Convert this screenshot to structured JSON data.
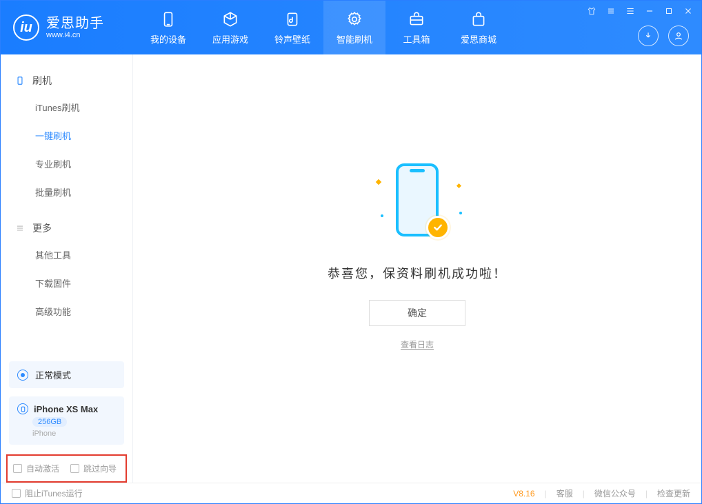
{
  "header": {
    "logo_title": "爱思助手",
    "logo_sub": "www.i4.cn",
    "nav": [
      {
        "label": "我的设备",
        "icon": "phone-icon"
      },
      {
        "label": "应用游戏",
        "icon": "cube-icon"
      },
      {
        "label": "铃声壁纸",
        "icon": "music-icon"
      },
      {
        "label": "智能刷机",
        "icon": "refresh-badge-icon",
        "active": true
      },
      {
        "label": "工具箱",
        "icon": "toolbox-icon"
      },
      {
        "label": "爱思商城",
        "icon": "store-icon"
      }
    ]
  },
  "sidebar": {
    "section1_title": "刷机",
    "items1": [
      {
        "label": "iTunes刷机"
      },
      {
        "label": "一键刷机",
        "active": true
      },
      {
        "label": "专业刷机"
      },
      {
        "label": "批量刷机"
      }
    ],
    "section2_title": "更多",
    "items2": [
      {
        "label": "其他工具"
      },
      {
        "label": "下载固件"
      },
      {
        "label": "高级功能"
      }
    ],
    "mode_label": "正常模式",
    "device": {
      "name": "iPhone XS Max",
      "capacity": "256GB",
      "type": "iPhone"
    },
    "checks": {
      "auto_activate": "自动激活",
      "skip_wizard": "跳过向导"
    }
  },
  "main": {
    "success_msg": "恭喜您，保资料刷机成功啦！",
    "ok_label": "确定",
    "log_link": "查看日志"
  },
  "footer": {
    "stop_itunes": "阻止iTunes运行",
    "version": "V8.16",
    "support": "客服",
    "wechat": "微信公众号",
    "check_update": "检查更新"
  }
}
